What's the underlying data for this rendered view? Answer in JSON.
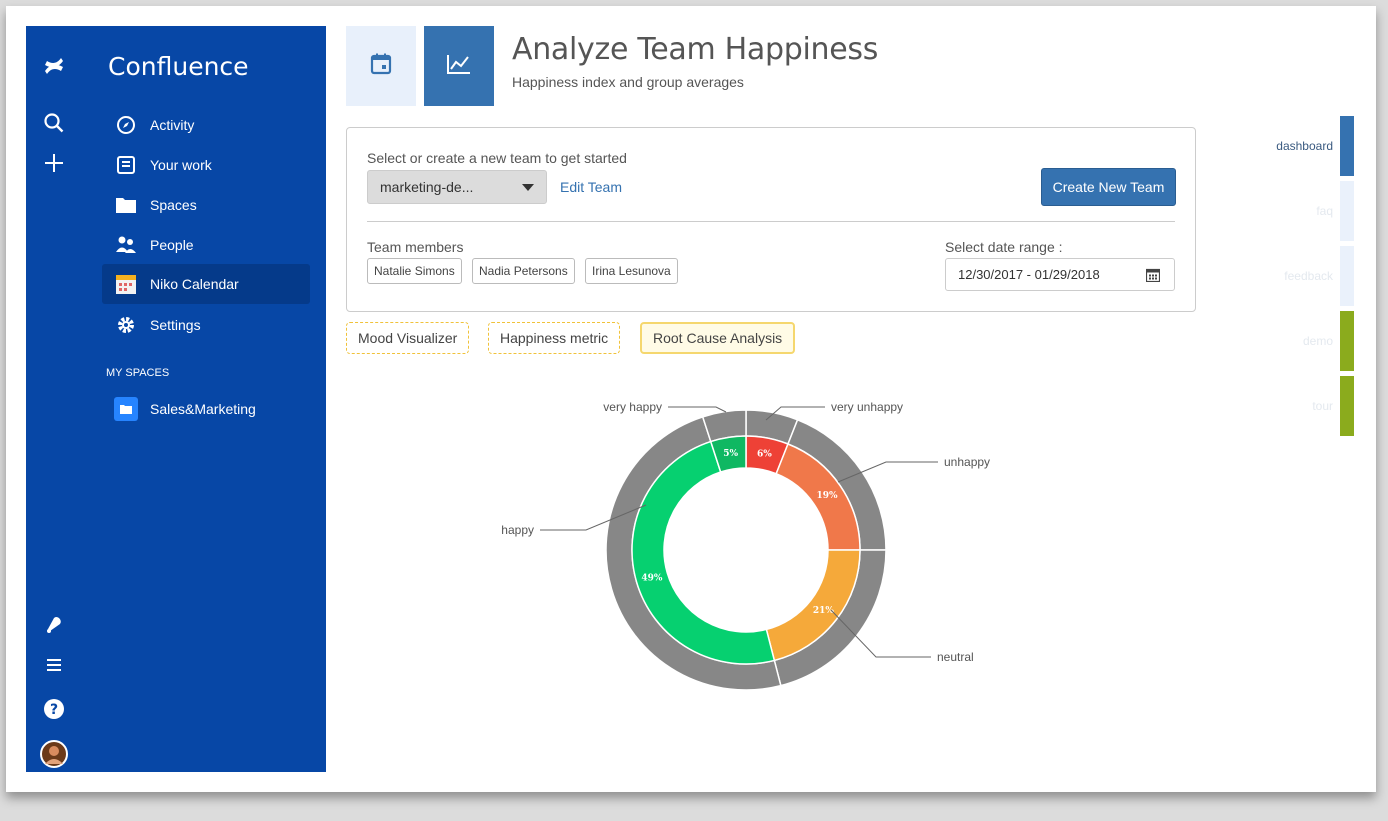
{
  "app": {
    "name": "Confluence"
  },
  "sidebar": {
    "items": [
      {
        "label": "Activity",
        "icon": "compass-icon"
      },
      {
        "label": "Your work",
        "icon": "document-icon"
      },
      {
        "label": "Spaces",
        "icon": "folder-icon"
      },
      {
        "label": "People",
        "icon": "people-icon"
      },
      {
        "label": "Niko Calendar",
        "icon": "calendar-app-icon",
        "active": true
      },
      {
        "label": "Settings",
        "icon": "gear-icon"
      }
    ],
    "my_spaces_heading": "MY SPACES",
    "spaces": [
      {
        "label": "Sales&Marketing",
        "icon": "space-icon"
      }
    ]
  },
  "header": {
    "title": "Analyze Team Happiness",
    "subtitle": "Happiness index and group averages"
  },
  "team_card": {
    "select_label": "Select or create a new team to get started",
    "team_select_value": "marketing-de...",
    "edit_team_label": "Edit Team",
    "create_button_label": "Create New Team",
    "members_label": "Team members",
    "members": [
      "Natalie Simons",
      "Nadia Petersons",
      "Irina Lesunova"
    ],
    "date_range_label": "Select date range :",
    "date_range_value": "12/30/2017 - 01/29/2018"
  },
  "tabs": [
    {
      "label": "Mood Visualizer",
      "active": false
    },
    {
      "label": "Happiness metric",
      "active": false
    },
    {
      "label": "Root Cause Analysis",
      "active": true
    }
  ],
  "right_sidebar": [
    {
      "label": "dashboard",
      "color": "#3572b0",
      "active": true
    },
    {
      "label": "faq",
      "color": "#eaf1fb",
      "active": false
    },
    {
      "label": "feedback",
      "color": "#eaf1fb",
      "active": false
    },
    {
      "label": "demo",
      "color": "#8bab1d",
      "active": false
    },
    {
      "label": "tour",
      "color": "#8bab1d",
      "active": false
    }
  ],
  "chart_data": {
    "type": "pie",
    "variant": "donut",
    "categories": [
      "very unhappy",
      "unhappy",
      "neutral",
      "happy",
      "very happy"
    ],
    "values": [
      6,
      19,
      21,
      49,
      5
    ],
    "value_labels": [
      "6%",
      "19%",
      "21%",
      "49%",
      "5%"
    ],
    "colors": [
      "#ee4136",
      "#f0784a",
      "#f5a93a",
      "#06d070",
      "#0fb862"
    ],
    "outer_ring_color": "#878787"
  }
}
